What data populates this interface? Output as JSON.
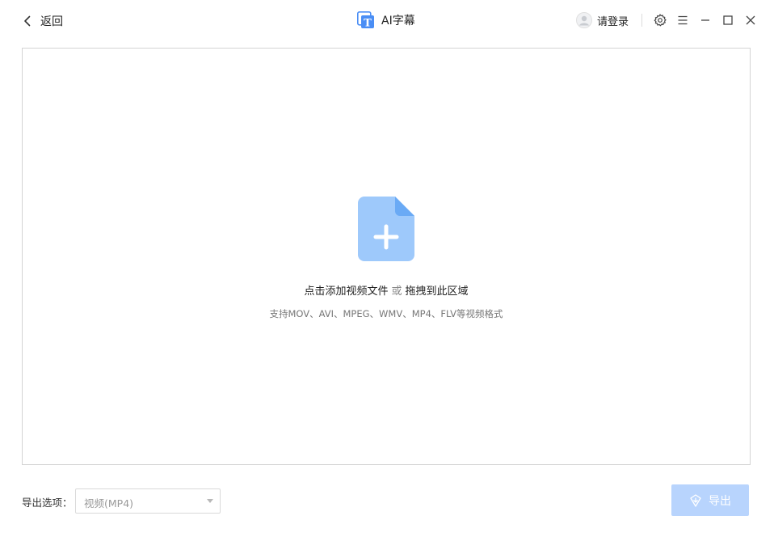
{
  "titlebar": {
    "back_label": "返回",
    "app_title": "AI字幕",
    "login_label": "请登录"
  },
  "dropzone": {
    "hint_primary": "点击添加视频文件",
    "hint_or": "或",
    "hint_secondary": "拖拽到此区域",
    "formats": "支持MOV、AVI、MPEG、WMV、MP4、FLV等视频格式"
  },
  "footer": {
    "export_options_label": "导出选项：",
    "format_select_value": "视频(MP4)",
    "export_button_label": "导出"
  },
  "colors": {
    "accent": "#4a8ef5",
    "file_icon_light": "#9ec9fb",
    "file_icon_fold": "#6aaaf5",
    "export_button_disabled": "#b8d4fd"
  },
  "icons": [
    "chevron-left-icon",
    "subtitle-logo-icon",
    "user-avatar-icon",
    "gear-icon",
    "menu-icon",
    "minimize-icon",
    "maximize-icon",
    "close-icon",
    "add-file-icon",
    "export-icon"
  ]
}
